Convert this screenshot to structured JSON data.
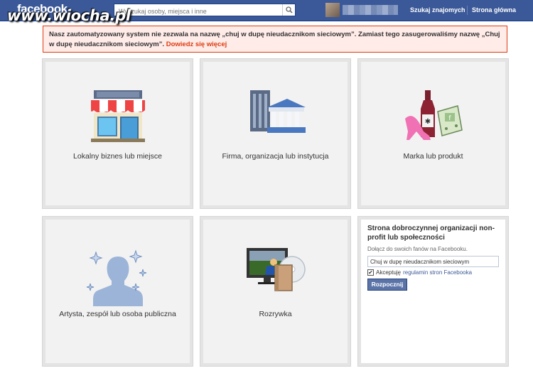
{
  "header": {
    "logo": "facebook",
    "watermark": "www.wiocha.pl",
    "search_placeholder": "Wyszukaj osoby, miejsca i inne",
    "nav": [
      "Szukaj znajomych",
      "Strona główna"
    ]
  },
  "notice": {
    "text": "Nasz zautomatyzowany system nie zezwala na nazwę „chuj w dupę nieudacznikom sieciowym”. Zamiast tego zasugerowaliśmy nazwę „Chuj w dupę nieudacznikom sieciowym”.",
    "link": "Dowiedz się więcej"
  },
  "tiles": [
    {
      "label": "Lokalny biznes lub miejsce"
    },
    {
      "label": "Firma, organizacja lub instytucja"
    },
    {
      "label": "Marka lub produkt"
    },
    {
      "label": "Artysta, zespół lub osoba publiczna"
    },
    {
      "label": "Rozrywka"
    }
  ],
  "charity": {
    "title": "Strona dobroczynnej organizacji non-profit lub społeczności",
    "subtitle": "Dołącz do swoich fanów na Facebooku.",
    "name_value": "Chuj w dupę nieudacznikom sieciowym",
    "accept_text": "Akceptuję",
    "terms_link": "regulamin stron Facebooka",
    "checked": true,
    "button": "Rozpocznij"
  },
  "colors": {
    "brand": "#3b5998",
    "notice_border": "#dd3c10"
  }
}
